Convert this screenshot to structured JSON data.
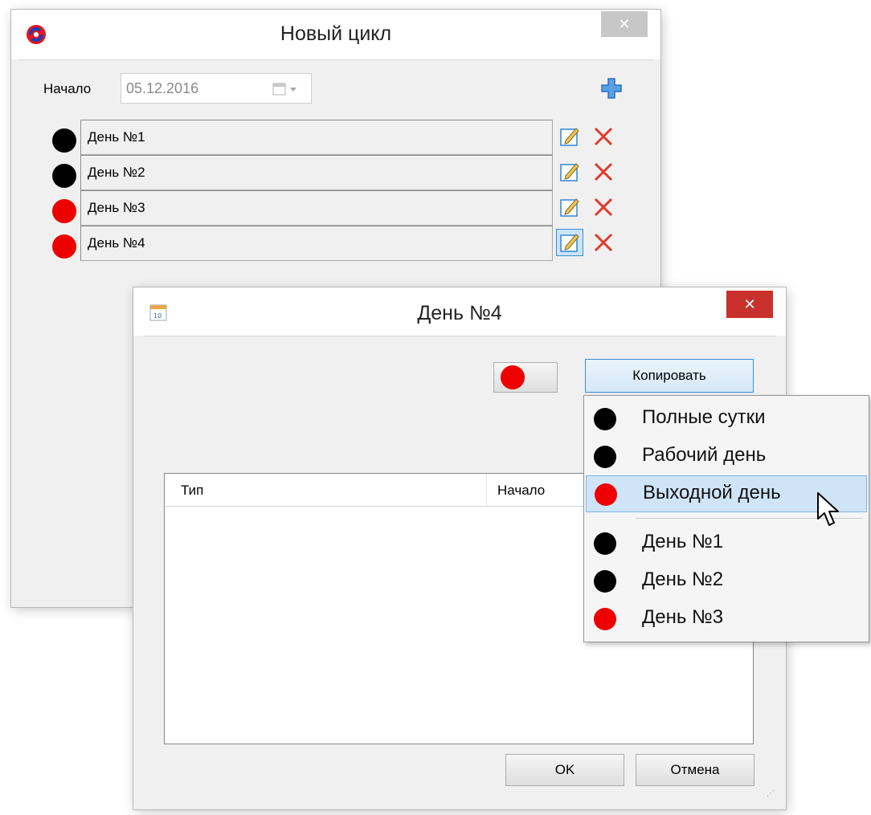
{
  "main_window": {
    "title": "Новый цикл",
    "close_glyph": "✕",
    "start_label": "Начало",
    "start_date": "05.12.2016",
    "add_icon": "plus-icon",
    "days": [
      {
        "label": "День №1",
        "color": "#000000"
      },
      {
        "label": "День №2",
        "color": "#000000"
      },
      {
        "label": "День №3",
        "color": "#ee0000"
      },
      {
        "label": "День №4",
        "color": "#ee0000"
      }
    ]
  },
  "day_dialog": {
    "title": "День №4",
    "close_glyph": "✕",
    "color_indicator": "#ee0000",
    "copy_button": "Копировать",
    "table": {
      "columns": [
        "Тип",
        "Начало"
      ]
    },
    "ok_button": "OK",
    "cancel_button": "Отмена"
  },
  "copy_menu": {
    "items": [
      {
        "label": "Полные сутки",
        "color": "#000000"
      },
      {
        "label": "Рабочий день",
        "color": "#000000"
      },
      {
        "label": "Выходной день",
        "color": "#ee0000",
        "highlighted": true
      },
      {
        "label": "День №1",
        "color": "#000000"
      },
      {
        "label": "День №2",
        "color": "#000000"
      },
      {
        "label": "День №3",
        "color": "#ee0000"
      }
    ]
  }
}
